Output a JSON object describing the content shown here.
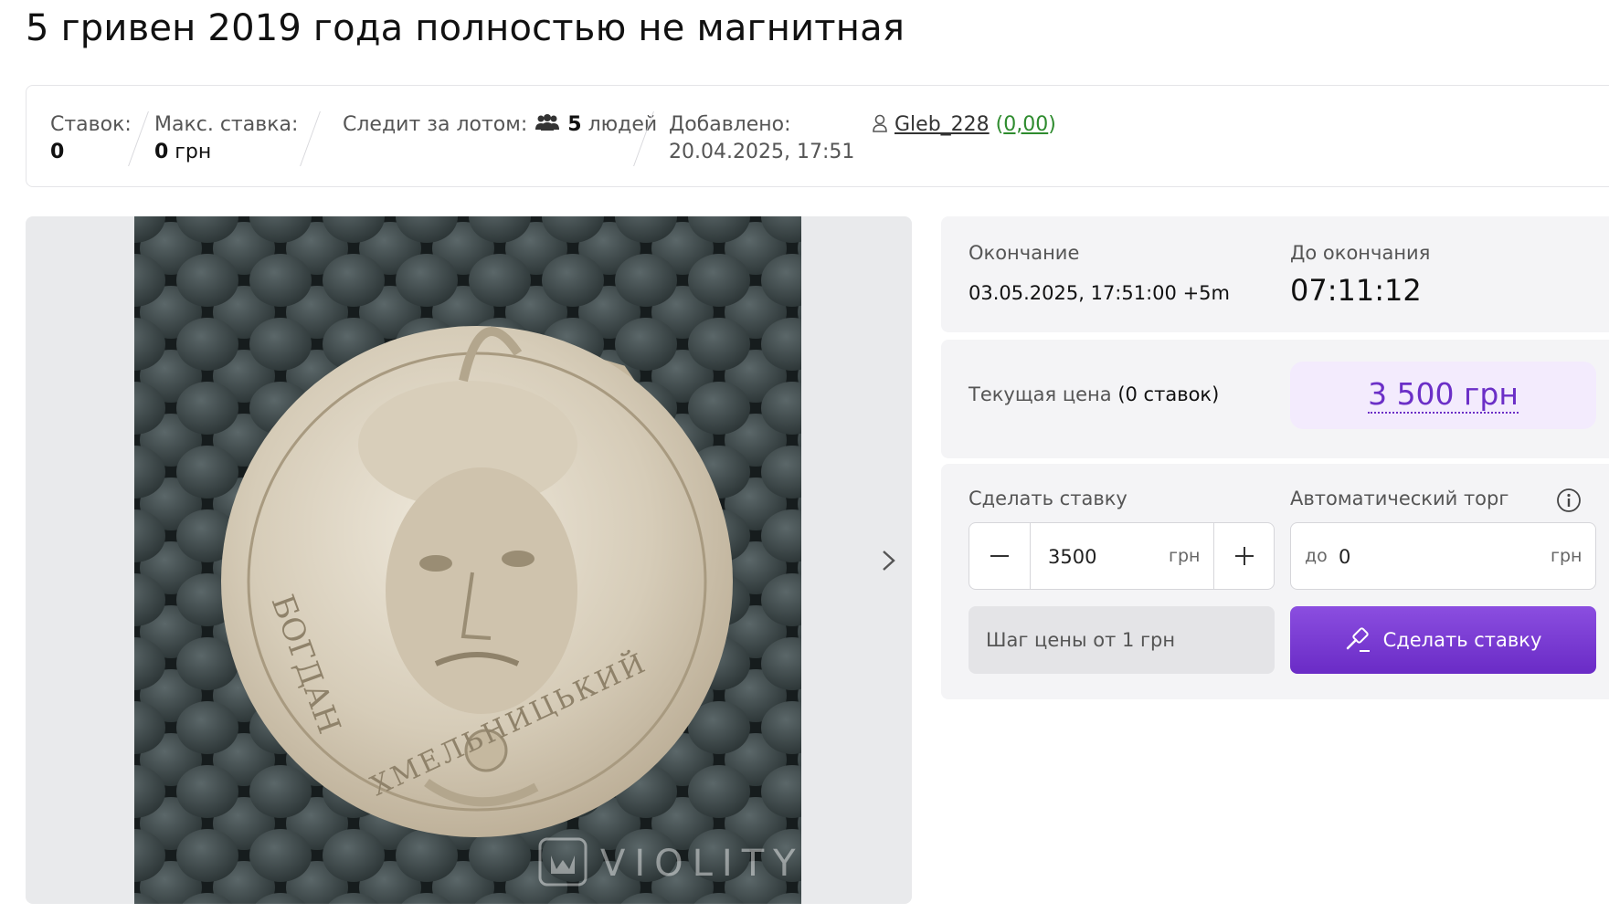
{
  "title": "5 гривен 2019 года полностью не магнитная",
  "stats": {
    "bids_label": "Ставок:",
    "bids_value": "0",
    "max_bid_label": "Макс. ставка:",
    "max_bid_amount": "0",
    "max_bid_currency": " грн",
    "watchers_label": "Следит за лотом:",
    "watchers_count": "5",
    "watchers_suffix": " людей",
    "added_label": "Добавлено:",
    "added_value": "20.04.2025, 17:51",
    "seller_name": "Gleb_228",
    "seller_rating": "0,00"
  },
  "gallery": {
    "watermark": "VIOLITY",
    "coin_legend_left": "БОГДАН",
    "coin_legend_bottom": "ХМЕЛЬНИЦЬКИЙ"
  },
  "timing": {
    "end_label": "Окончание",
    "end_value": "03.05.2025, 17:51:00 +5m",
    "remaining_label": "До окончания",
    "remaining_value": "07:11:12"
  },
  "price": {
    "label": "Текущая цена",
    "bids_note": "(0 ставок)",
    "value": "3 500 грн"
  },
  "bid": {
    "label": "Сделать ставку",
    "amount": "3500",
    "currency": "грн",
    "auto_label": "Автоматический торг",
    "auto_prefix": "до",
    "auto_value": "0",
    "auto_currency": "грн",
    "step_text": "Шаг цены от 1 грн",
    "button_label": "Сделать ставку"
  },
  "colors": {
    "accent": "#7a3dd6",
    "price_bg": "#f3ebfd",
    "panel_bg": "#f4f4f6",
    "rating": "#2e8b2e"
  }
}
